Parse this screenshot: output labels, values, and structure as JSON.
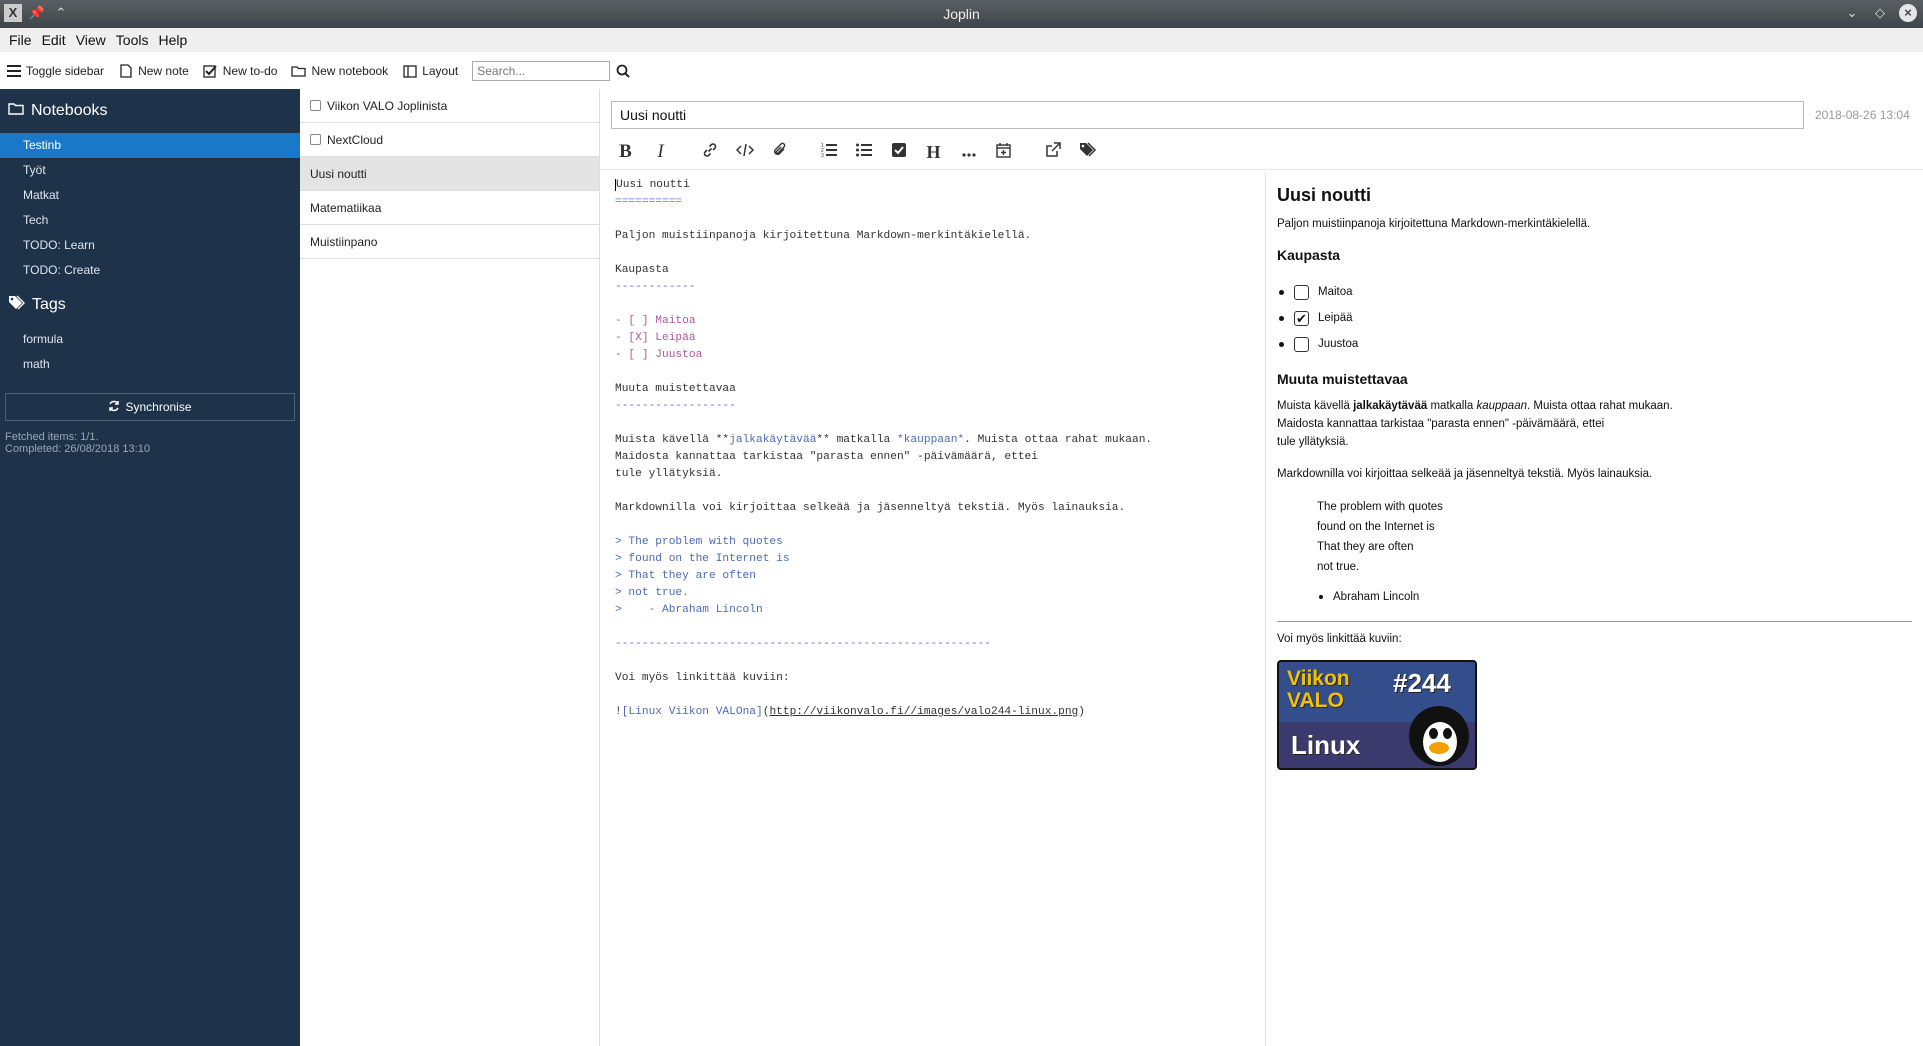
{
  "window": {
    "title": "Joplin"
  },
  "menu": [
    "File",
    "Edit",
    "View",
    "Tools",
    "Help"
  ],
  "toolbar": {
    "toggle_sidebar": "Toggle sidebar",
    "new_note": "New note",
    "new_todo": "New to-do",
    "new_notebook": "New notebook",
    "layout": "Layout",
    "search_placeholder": "Search..."
  },
  "sidebar": {
    "notebooks_header": "Notebooks",
    "notebooks": [
      "Testinb",
      "Työt",
      "Matkat",
      "Tech",
      "TODO: Learn",
      "TODO: Create"
    ],
    "active_notebook": "Testinb",
    "tags_header": "Tags",
    "tags": [
      "formula",
      "math"
    ],
    "sync_label": "Synchronise",
    "sync_status_1": "Fetched items: 1/1.",
    "sync_status_2": "Completed: 26/08/2018 13:10"
  },
  "notes": [
    {
      "title": "Viikon VALO Joplinista",
      "todo": true
    },
    {
      "title": "NextCloud",
      "todo": true
    },
    {
      "title": "Uusi noutti",
      "todo": false,
      "selected": true
    },
    {
      "title": "Matematiikaa",
      "todo": false
    },
    {
      "title": "Muistiinpano",
      "todo": false
    }
  ],
  "editor": {
    "title": "Uusi noutti",
    "date": "2018-08-26 13:04",
    "md": {
      "l1": "Uusi noutti",
      "l2": "==========",
      "l4": "Paljon muistiinpanoja kirjoitettuna Markdown-merkintäkielellä.",
      "l6": "Kaupasta",
      "l7": "------------",
      "l9": "- [ ] Maitoa",
      "l10": "- [X] Leipää",
      "l11": "- [ ] Juustoa",
      "l13": "Muuta muistettavaa",
      "l14": "------------------",
      "l16a": "Muista kävellä **",
      "l16b": "jalkakäytävää",
      "l16c": "** matkalla ",
      "l16d": "*kauppaan*",
      "l16e": ". Muista ottaa rahat mukaan.",
      "l17": "Maidosta kannattaa tarkistaa \"parasta ennen\" -päivämäärä, ettei",
      "l18": "tule yllätyksiä.",
      "l20": "Markdownilla voi kirjoittaa selkeää ja jäsenneltyä tekstiä. Myös lainauksia.",
      "l22": "> The problem with quotes",
      "l23": "> found on the Internet is",
      "l24": "> That they are often",
      "l25": "> not true.",
      "l26": ">    - Abraham Lincoln",
      "l28": "--------------------------------------------------------",
      "l30": "Voi myös linkittää kuviin:",
      "l32a": "!",
      "l32b": "[Linux Viikon VALOna]",
      "l32c": "(",
      "l32d": "http://viikonvalo.fi//images/valo244-linux.png",
      "l32e": ")"
    }
  },
  "preview": {
    "h1": "Uusi noutti",
    "p1": "Paljon muistiinpanoja kirjoitettuna Markdown-merkintäkielellä.",
    "h2a": "Kaupasta",
    "items": [
      {
        "label": "Maitoa",
        "checked": false
      },
      {
        "label": "Leipää",
        "checked": true
      },
      {
        "label": "Juustoa",
        "checked": false
      }
    ],
    "h2b": "Muuta muistettavaa",
    "p2a": "Muista kävellä ",
    "p2b": "jalkakäytävää",
    "p2c": " matkalla ",
    "p2d": "kauppaan",
    "p2e": ". Muista ottaa rahat mukaan.",
    "p2f": "Maidosta kannattaa tarkistaa \"parasta ennen\" -päivämäärä, ettei",
    "p2g": "tule yllätyksiä.",
    "p3": "Markdownilla voi kirjoittaa selkeää ja jäsenneltyä tekstiä. Myös lainauksia.",
    "quote": [
      "The problem with quotes",
      "found on the Internet is",
      "That they are often",
      "not true."
    ],
    "quote_author": "Abraham Lincoln",
    "p4": "Voi myös linkittää kuviin:",
    "image_text": {
      "viikon": "Viikon",
      "valo": "VALO",
      "num": "#244",
      "linux": "Linux"
    }
  },
  "colors": {
    "sidebar_bg": "#1e3249",
    "active_item": "#1a78c8"
  }
}
